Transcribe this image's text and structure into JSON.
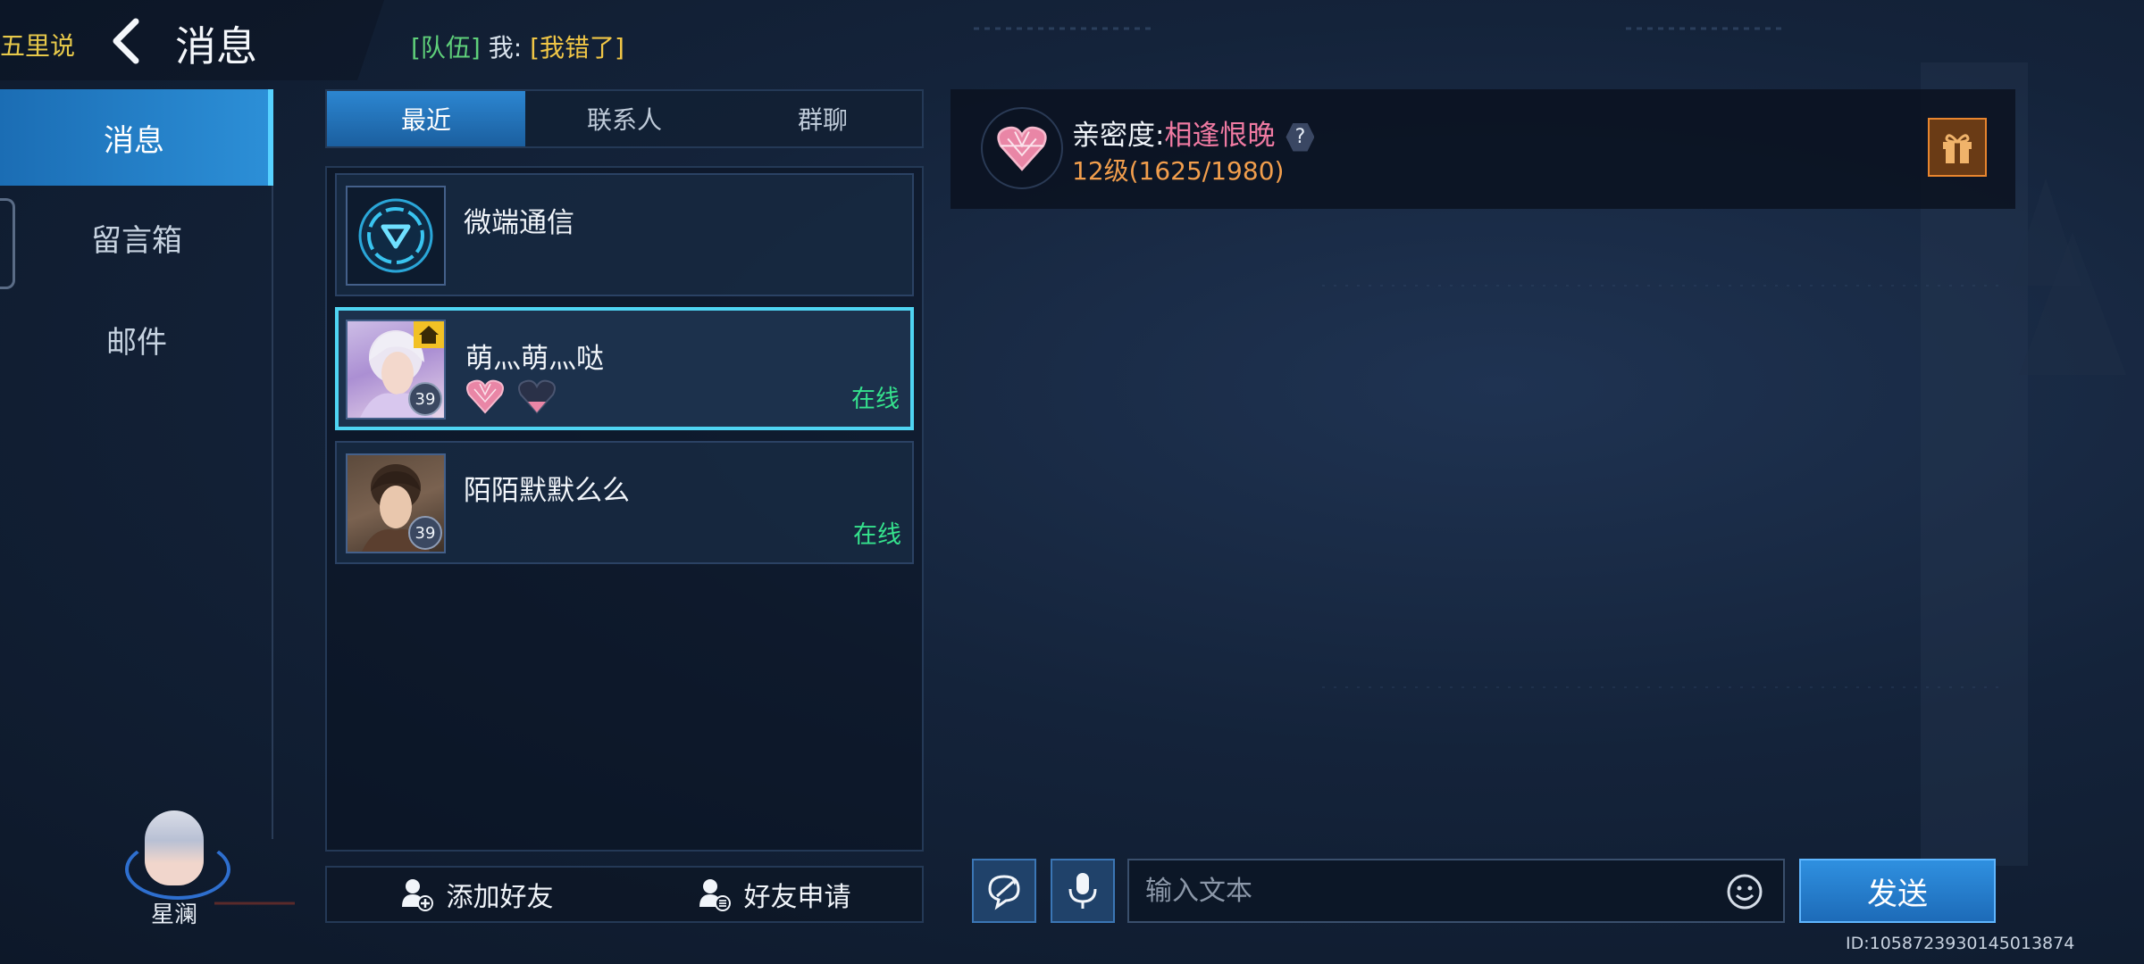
{
  "top": {
    "left_text": "五里说",
    "title": "消息",
    "broadcast": {
      "team": "[队伍]",
      "me": "我:",
      "message": "[我错了]"
    }
  },
  "nav": {
    "items": [
      {
        "label": "消息",
        "active": true
      },
      {
        "label": "留言箱",
        "active": false
      },
      {
        "label": "邮件",
        "active": false
      }
    ],
    "avatar_name": "星澜"
  },
  "list": {
    "tabs": [
      {
        "label": "最近",
        "active": true
      },
      {
        "label": "联系人",
        "active": false
      },
      {
        "label": "群聊",
        "active": false
      }
    ],
    "items": [
      {
        "name": "微端通信",
        "status": "",
        "level": ""
      },
      {
        "name": "萌灬萌灬哒",
        "status": "在线",
        "level": "39",
        "selected": true
      },
      {
        "name": "陌陌默默么么",
        "status": "在线",
        "level": "39"
      }
    ],
    "add_friend": "添加好友",
    "friend_request": "好友申请"
  },
  "chat": {
    "intimacy_label": "亲密度:",
    "intimacy_value": "相逢恨晚",
    "help": "?",
    "intimacy_level": "12级(1625/1980)",
    "input_placeholder": "输入文本",
    "send_label": "发送",
    "user_id": "ID:1058723930145013874"
  },
  "colors": {
    "accent": "#2c8fd7",
    "online": "#35e28d",
    "intimacy": "#f07aa2",
    "level": "#f29e4c",
    "team_tag": "#5fd07a",
    "broadcast_msg": "#f0c646"
  }
}
